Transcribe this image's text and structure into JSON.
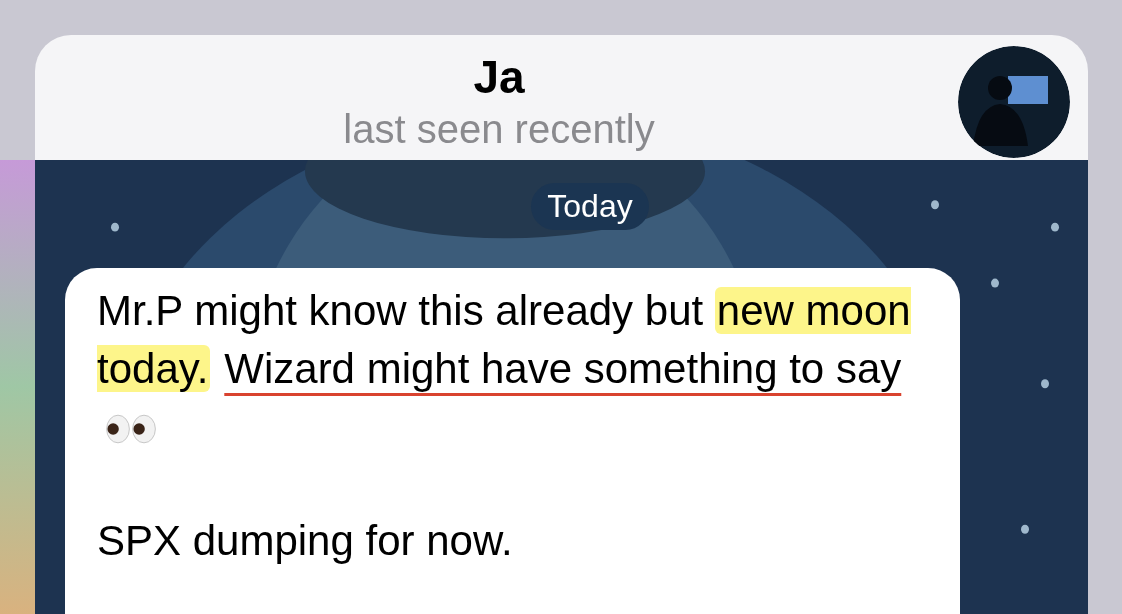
{
  "header": {
    "title": "Ja",
    "subtitle": "last seen recently"
  },
  "date_badge": "Today",
  "message": {
    "paragraphs": [
      {
        "segments": [
          {
            "kind": "text",
            "text": "Mr.P might know this already but "
          },
          {
            "kind": "highlight",
            "text": "new moon today."
          },
          {
            "kind": "underline",
            "text": "Wizard might have something to say"
          },
          {
            "kind": "emoji"
          }
        ]
      },
      {
        "segments": [
          {
            "kind": "text",
            "text": "SPX dumping for now."
          }
        ]
      }
    ]
  }
}
